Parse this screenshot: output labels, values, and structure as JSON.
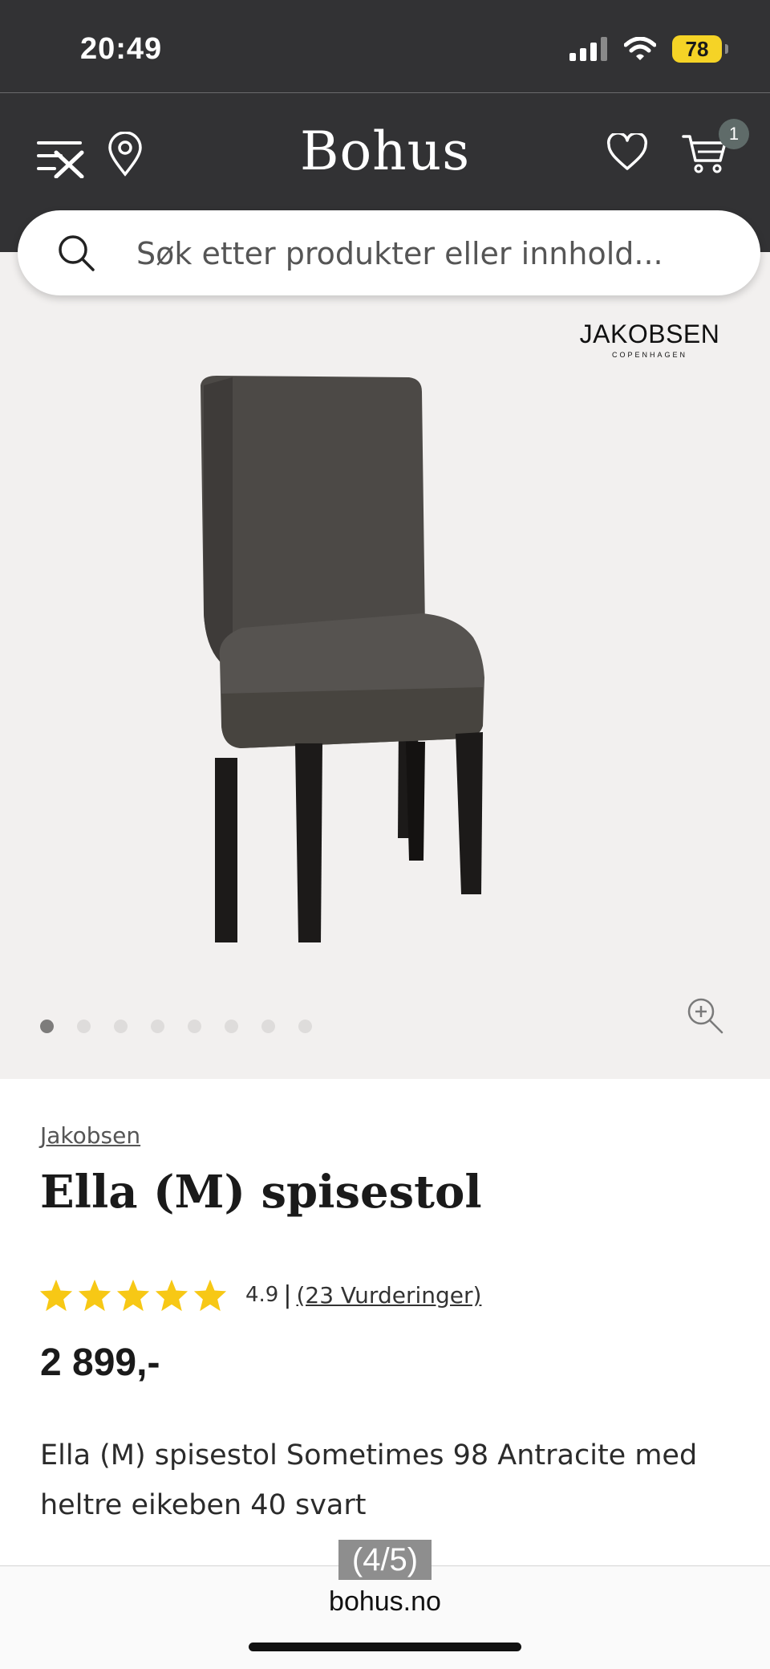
{
  "status_bar": {
    "time": "20:49",
    "battery": "78"
  },
  "header": {
    "logo": "Bohus",
    "cart_count": "1"
  },
  "search": {
    "placeholder": "Søk etter produkter eller innhold..."
  },
  "gallery": {
    "brand_logo_main": "JAKOBSEN",
    "brand_logo_sub": "COPENHAGEN",
    "dot_count": 8,
    "active_index": 0
  },
  "product": {
    "brand": "Jakobsen",
    "title": "Ella (M) spisestol",
    "rating_value": "4.9",
    "rating_count_label": "(23 Vurderinger)",
    "price": "2 899,-",
    "description": "Ella (M) spisestol Sometimes 98 Antracite med heltre eikeben 40 svart"
  },
  "browser": {
    "page_indicator": "(4/5)",
    "url": "bohus.no"
  },
  "colors": {
    "header_bg": "#323234",
    "star": "#f7c815",
    "battery": "#f5d326",
    "badge": "#5f6b69"
  }
}
